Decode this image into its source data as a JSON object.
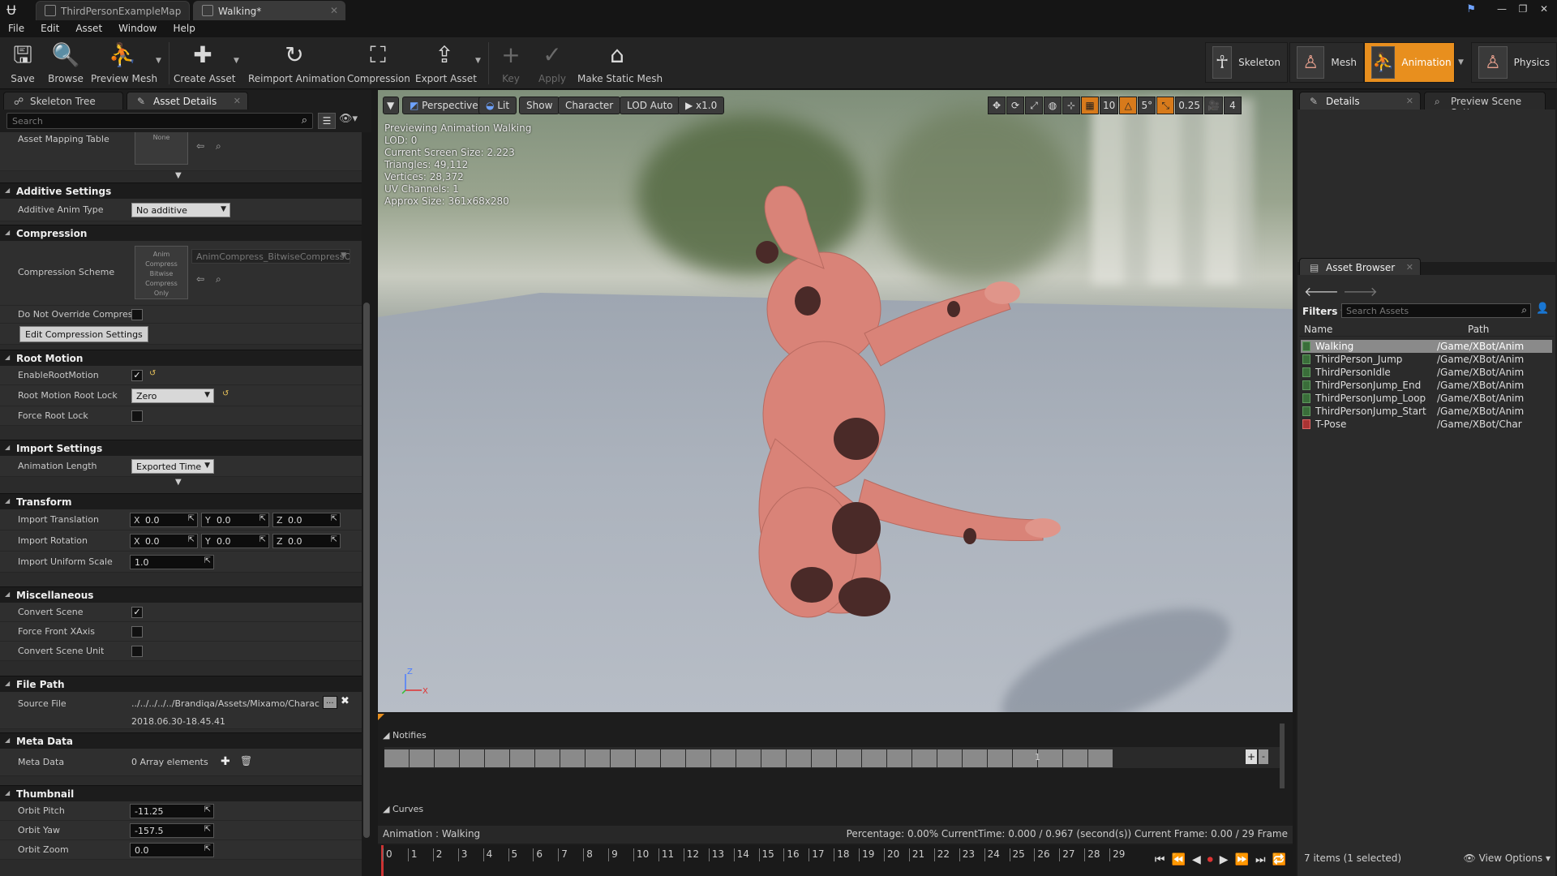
{
  "titlebar": {
    "tabs": [
      {
        "label": "ThirdPersonExampleMap"
      },
      {
        "label": "Walking*"
      }
    ]
  },
  "menu": [
    "File",
    "Edit",
    "Asset",
    "Window",
    "Help"
  ],
  "toolbar": {
    "buttons": [
      {
        "label": "Save",
        "icon": "save-icon"
      },
      {
        "label": "Browse",
        "icon": "browse-icon"
      },
      {
        "label": "Preview Mesh",
        "icon": "preview-mesh-icon"
      },
      {
        "label": "Create Asset",
        "icon": "create-asset-icon"
      },
      {
        "label": "Reimport Animation",
        "icon": "reimport-icon"
      },
      {
        "label": "Compression",
        "icon": "compression-icon"
      },
      {
        "label": "Export Asset",
        "icon": "export-icon"
      },
      {
        "label": "Key",
        "icon": "plus-icon"
      },
      {
        "label": "Apply",
        "icon": "apply-icon"
      },
      {
        "label": "Make Static Mesh",
        "icon": "static-mesh-icon"
      }
    ],
    "modes": [
      {
        "label": "Skeleton"
      },
      {
        "label": "Mesh"
      },
      {
        "label": "Animation",
        "active": true
      },
      {
        "label": "Physics"
      }
    ]
  },
  "left_panel": {
    "tabs": [
      {
        "label": "Skeleton Tree"
      },
      {
        "label": "Asset Details"
      }
    ],
    "search_placeholder": "Search",
    "asset_mapping": {
      "label": "Asset Mapping Table",
      "thumb": "None"
    },
    "additive": {
      "header": "Additive Settings",
      "label": "Additive Anim Type",
      "value": "No additive"
    },
    "compression": {
      "header": "Compression",
      "scheme_label": "Compression Scheme",
      "thumb_lines": [
        "Anim",
        "Compress",
        "Bitwise",
        "Compress",
        "Only"
      ],
      "scheme_value": "AnimCompress_BitwiseCompressOn",
      "override_label": "Do Not Override Compress",
      "edit_button": "Edit Compression Settings"
    },
    "root_motion": {
      "header": "Root Motion",
      "enable_label": "EnableRootMotion",
      "enable_checked": true,
      "lock_label": "Root Motion Root Lock",
      "lock_value": "Zero",
      "force_label": "Force Root Lock"
    },
    "import": {
      "header": "Import Settings",
      "length_label": "Animation Length",
      "length_value": "Exported Time"
    },
    "transform": {
      "header": "Transform",
      "translation_label": "Import Translation",
      "translation": {
        "x": "0.0",
        "y": "0.0",
        "z": "0.0"
      },
      "rotation_label": "Import Rotation",
      "rotation": {
        "x": "0.0",
        "y": "0.0",
        "z": "0.0"
      },
      "scale_label": "Import Uniform Scale",
      "scale": "1.0"
    },
    "misc": {
      "header": "Miscellaneous",
      "convert_scene": "Convert Scene",
      "convert_scene_checked": true,
      "force_front": "Force Front XAxis",
      "convert_unit": "Convert Scene Unit"
    },
    "file_path": {
      "header": "File Path",
      "label": "Source File",
      "path": "../../../../../Brandiqa/Assets/Mixamo/Charac",
      "browse": "...",
      "timestamp": "2018.06.30-18.45.41"
    },
    "meta": {
      "header": "Meta Data",
      "label": "Meta Data",
      "value": "0 Array elements"
    },
    "thumbnail": {
      "header": "Thumbnail",
      "pitch_label": "Orbit Pitch",
      "pitch": "-11.25",
      "yaw_label": "Orbit Yaw",
      "yaw": "-157.5",
      "zoom_label": "Orbit Zoom",
      "zoom": "0.0"
    }
  },
  "viewport": {
    "toolbar": {
      "perspective": "Perspective",
      "lit": "Lit",
      "show": "Show",
      "character": "Character",
      "lod": "LOD Auto",
      "speed": "x1.0",
      "grid": "10",
      "angle": "5°",
      "scale": "0.25",
      "camera_speed": "4"
    },
    "info": [
      "Previewing Animation Walking",
      "LOD: 0",
      "Current Screen Size: 2.223",
      "Triangles: 49,112",
      "Vertices: 28,372",
      "UV Channels: 1",
      "Approx Size: 361x68x280"
    ],
    "axis": {
      "z": "Z",
      "x": "X"
    }
  },
  "timeline": {
    "notifies": "Notifies",
    "count": "1",
    "curves": "Curves",
    "animation_label": "Animation :",
    "animation_name": "Walking",
    "status": "Percentage:  0.00%  CurrentTime:  0.000 / 0.967 (second(s))  Current Frame:  0.00 / 29 Frame",
    "ticks": [
      "0",
      "1",
      "2",
      "3",
      "4",
      "5",
      "6",
      "7",
      "8",
      "9",
      "10",
      "11",
      "12",
      "13",
      "14",
      "15",
      "16",
      "17",
      "18",
      "19",
      "20",
      "21",
      "22",
      "23",
      "24",
      "25",
      "26",
      "27",
      "28",
      "29"
    ]
  },
  "right_panel": {
    "tabs": [
      {
        "label": "Details"
      },
      {
        "label": "Preview Scene Sett"
      }
    ],
    "asset_browser": {
      "tab": "Asset Browser",
      "filters": "Filters",
      "search_placeholder": "Search Assets",
      "col_name": "Name",
      "col_path": "Path",
      "items": [
        {
          "name": "Walking",
          "path": "/Game/XBot/Anim",
          "selected": true
        },
        {
          "name": "ThirdPerson_Jump",
          "path": "/Game/XBot/Anim"
        },
        {
          "name": "ThirdPersonIdle",
          "path": "/Game/XBot/Anim"
        },
        {
          "name": "ThirdPersonJump_End",
          "path": "/Game/XBot/Anim"
        },
        {
          "name": "ThirdPersonJump_Loop",
          "path": "/Game/XBot/Anim"
        },
        {
          "name": "ThirdPersonJump_Start",
          "path": "/Game/XBot/Anim"
        },
        {
          "name": "T-Pose",
          "path": "/Game/XBot/Char"
        }
      ],
      "footer": "7 items (1 selected)",
      "view_options": "View Options"
    }
  },
  "colors": {
    "accent": "#e88f1e",
    "selection": "#8a8a8a",
    "record": "#cc3333"
  }
}
